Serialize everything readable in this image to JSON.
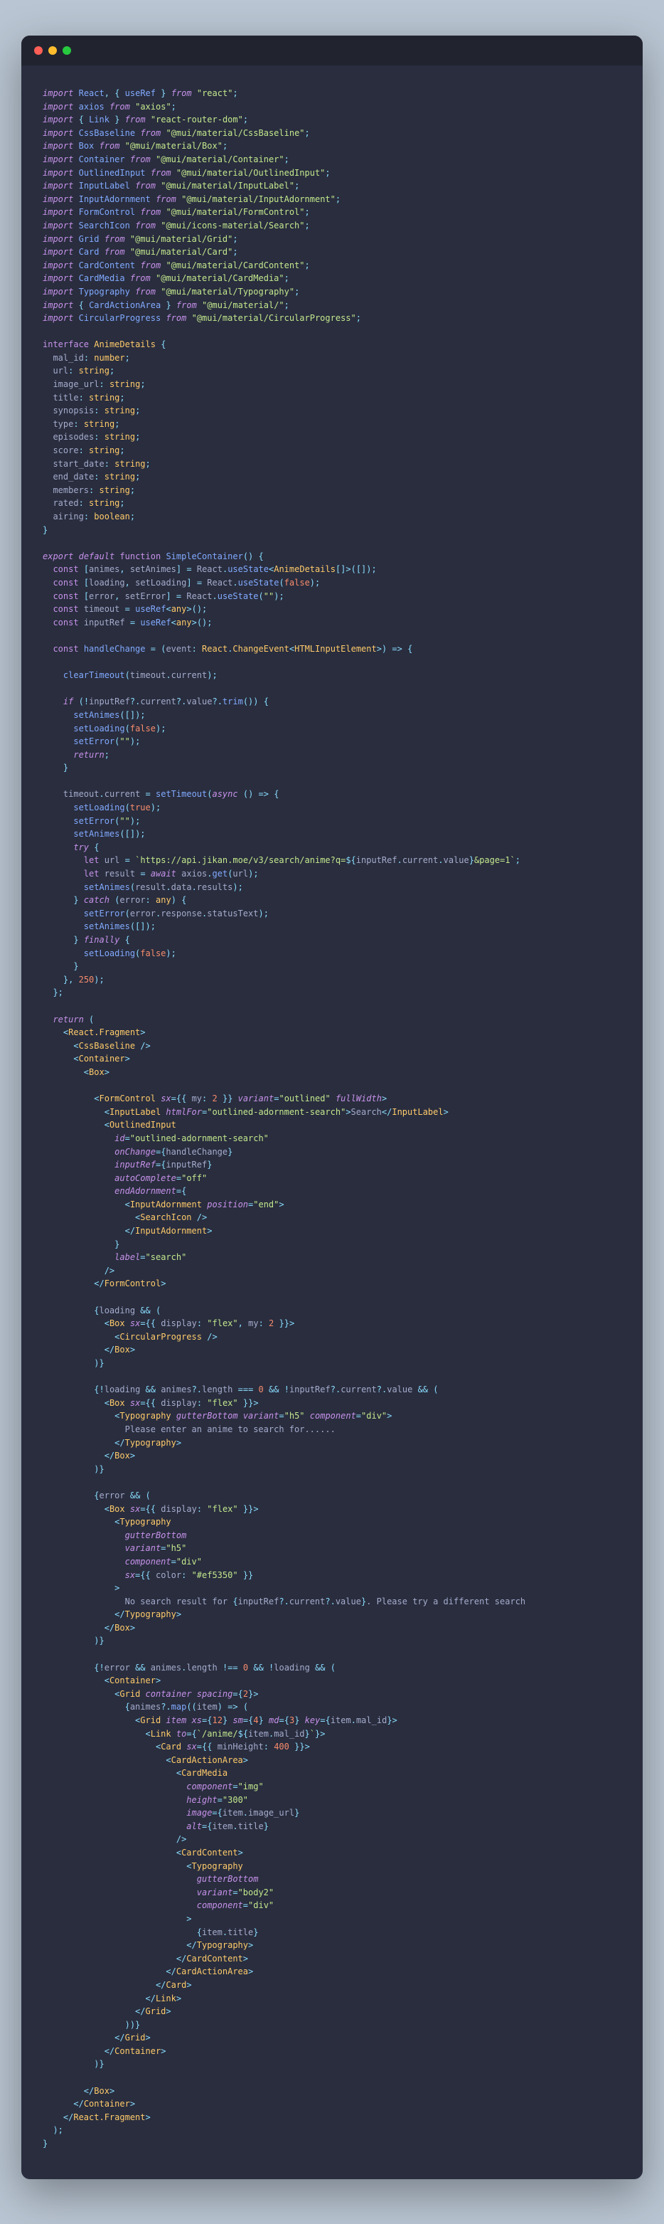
{
  "window": {
    "title": ""
  },
  "code": {
    "imports": [
      {
        "k": "import",
        "what": "React, { useRef }",
        "from": "\"react\""
      },
      {
        "k": "import",
        "what": "axios",
        "from": "\"axios\""
      },
      {
        "k": "import",
        "what": "{ Link }",
        "from": "\"react-router-dom\""
      },
      {
        "k": "import",
        "what": "CssBaseline",
        "from": "\"@mui/material/CssBaseline\""
      },
      {
        "k": "import",
        "what": "Box",
        "from": "\"@mui/material/Box\""
      },
      {
        "k": "import",
        "what": "Container",
        "from": "\"@mui/material/Container\""
      },
      {
        "k": "import",
        "what": "OutlinedInput",
        "from": "\"@mui/material/OutlinedInput\""
      },
      {
        "k": "import",
        "what": "InputLabel",
        "from": "\"@mui/material/InputLabel\""
      },
      {
        "k": "import",
        "what": "InputAdornment",
        "from": "\"@mui/material/InputAdornment\""
      },
      {
        "k": "import",
        "what": "FormControl",
        "from": "\"@mui/material/FormControl\""
      },
      {
        "k": "import",
        "what": "SearchIcon",
        "from": "\"@mui/icons-material/Search\""
      },
      {
        "k": "import",
        "what": "Grid",
        "from": "\"@mui/material/Grid\""
      },
      {
        "k": "import",
        "what": "Card",
        "from": "\"@mui/material/Card\""
      },
      {
        "k": "import",
        "what": "CardContent",
        "from": "\"@mui/material/CardContent\""
      },
      {
        "k": "import",
        "what": "CardMedia",
        "from": "\"@mui/material/CardMedia\""
      },
      {
        "k": "import",
        "what": "Typography",
        "from": "\"@mui/material/Typography\""
      },
      {
        "k": "import",
        "what": "{ CardActionArea }",
        "from": "\"@mui/material/\""
      },
      {
        "k": "import",
        "what": "CircularProgress",
        "from": "\"@mui/material/CircularProgress\""
      }
    ],
    "interface_name": "AnimeDetails",
    "interface_fields": [
      {
        "name": "mal_id",
        "type": "number"
      },
      {
        "name": "url",
        "type": "string"
      },
      {
        "name": "image_url",
        "type": "string"
      },
      {
        "name": "title",
        "type": "string"
      },
      {
        "name": "synopsis",
        "type": "string"
      },
      {
        "name": "type",
        "type": "string"
      },
      {
        "name": "episodes",
        "type": "string"
      },
      {
        "name": "score",
        "type": "string"
      },
      {
        "name": "start_date",
        "type": "string"
      },
      {
        "name": "end_date",
        "type": "string"
      },
      {
        "name": "members",
        "type": "string"
      },
      {
        "name": "rated",
        "type": "string"
      },
      {
        "name": "airing",
        "type": "boolean"
      }
    ],
    "function_name": "SimpleContainer",
    "state": [
      "const [animes, setAnimes] = React.useState<AnimeDetails[]>([]);",
      "const [loading, setLoading] = React.useState(false);",
      "const [error, setError] = React.useState(\"\");",
      "const timeout = useRef<any>();",
      "const inputRef = useRef<any>();"
    ],
    "handle_change_sig": "const handleChange = (event: React.ChangeEvent<HTMLInputElement>) => {",
    "clear_timeout": "clearTimeout(timeout.current);",
    "guard": [
      "if (!inputRef?.current?.value?.trim()) {",
      "  setAnimes([]);",
      "  setLoading(false);",
      "  setError(\"\");",
      "  return;",
      "}"
    ],
    "timeout_block": [
      "timeout.current = setTimeout(async () => {",
      "  setLoading(true);",
      "  setError(\"\");",
      "  setAnimes([]);",
      "  try {",
      "    let url = `https://api.jikan.moe/v3/search/anime?q=${inputRef.current.value}&page=1`;",
      "    let result = await axios.get(url);",
      "    setAnimes(result.data.results);",
      "  } catch (error: any) {",
      "    setError(error.response.statusText);",
      "    setAnimes([]);",
      "  } finally {",
      "    setLoading(false);",
      "  }",
      "}, 250);"
    ],
    "jsx": {
      "form_control_sx": "{{ my: 2 }}",
      "input_label_text": "Search",
      "outlined_input_id": "outlined-adornment-search",
      "auto_complete": "off",
      "input_adornment_pos": "end",
      "label": "search",
      "loading_sx": "{{ display: \"flex\", my: 2 }}",
      "empty_guard": "{!loading && animes?.length === 0 && !inputRef?.current?.value && (",
      "empty_box_sx": "{{ display: \"flex\" }}",
      "empty_text": "Please enter an anime to search for......",
      "error_box_sx": "{{ display: \"flex\" }}",
      "error_color": "#ef5350",
      "error_text_pre": "No search result for ",
      "error_text_suf": ". Please try a different search",
      "list_guard": "{!error && animes.length !== 0 && !loading && (",
      "grid_spacing": "2",
      "grid_item": "xs={12} sm={4} md={3}",
      "card_sx": "{{ minHeight: 400 }}",
      "media_height": "300"
    }
  }
}
